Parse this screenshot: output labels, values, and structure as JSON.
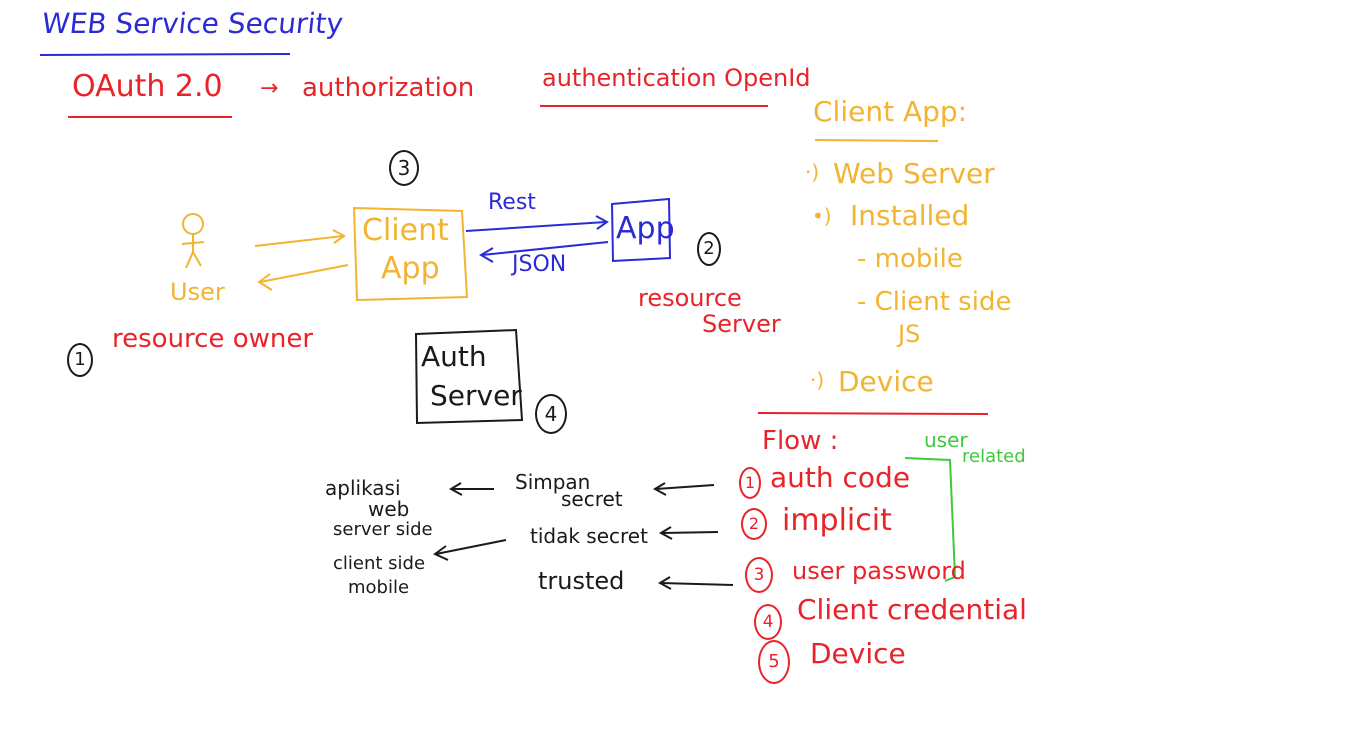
{
  "title": "WEB Service Security",
  "oauth": {
    "label": "OAuth 2.0",
    "arrow": "→",
    "purpose": "authorization"
  },
  "openid": {
    "label": "authentication OpenId"
  },
  "diagram": {
    "user": "User",
    "resource_owner_num": "1",
    "resource_owner": "resource owner",
    "client_app_num": "3",
    "client_app_line1": "Client",
    "client_app_line2": "App",
    "app": "App",
    "rest": "Rest",
    "json": "JSON",
    "resource_server_num": "2",
    "resource_server_line1": "resource",
    "resource_server_line2": "Server",
    "auth_server_line1": "Auth",
    "auth_server_line2": "Server",
    "auth_server_num": "4"
  },
  "client_app_types": {
    "heading": "Client App:",
    "items": [
      "Web Server",
      "Installed",
      "- mobile",
      "- Client side",
      "JS",
      "Device"
    ]
  },
  "flows": {
    "heading": "Flow :",
    "user_related_1": "user",
    "user_related_2": "related",
    "items": [
      {
        "num": "1",
        "label": "auth code"
      },
      {
        "num": "2",
        "label": "implicit"
      },
      {
        "num": "3",
        "label": "user password"
      },
      {
        "num": "4",
        "label": "Client credential"
      },
      {
        "num": "5",
        "label": "Device"
      }
    ],
    "secrets": [
      "Simpan secret",
      "tidak secret",
      "trusted"
    ],
    "secret_lines": {
      "simpan": "Simpan",
      "secret": "secret"
    },
    "apps": {
      "aplikasi": "aplikasi",
      "web": "web",
      "server_side": "server side",
      "client_side": "client side",
      "mobile": "mobile"
    }
  },
  "colors": {
    "blue": "#2b2bd6",
    "red": "#e8242a",
    "orange": "#f2b431",
    "green": "#3ec93a",
    "black": "#1a1a1a"
  }
}
